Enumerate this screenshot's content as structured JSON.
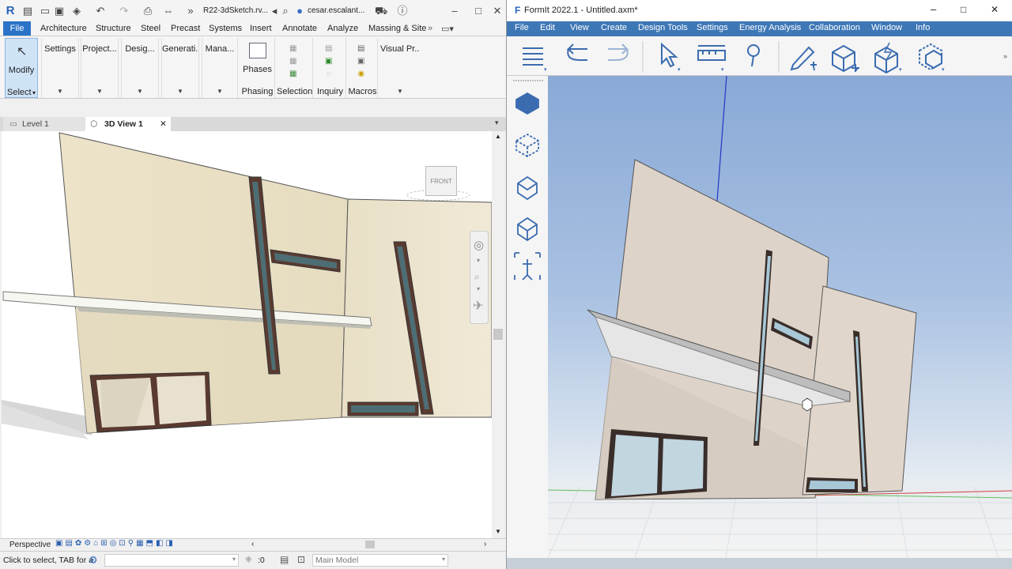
{
  "revit": {
    "qat_title": "R22-3dSketch.rv...",
    "user": "cesar.escalant...",
    "menu": {
      "file": "File",
      "items": [
        "Architecture",
        "Structure",
        "Steel",
        "Precast",
        "Systems",
        "Insert",
        "Annotate",
        "Analyze",
        "Massing & Site"
      ]
    },
    "ribbon": {
      "modify": "Modify",
      "select": "Select",
      "panels": [
        "Settings",
        "Project...",
        "Desig...",
        "Generati...",
        "Mana..."
      ],
      "phases": "Phases",
      "phasing": "Phasing",
      "selection": "Selection",
      "inquiry": "Inquiry",
      "macros": "Macros",
      "visual": "Visual Pr..."
    },
    "view_tabs": [
      "Level 1",
      "3D View 1"
    ],
    "viewcube_face": "FRONT",
    "view_control_label": "Perspective",
    "status": {
      "hint": "Click to select, TAB for a",
      "zero": ":0",
      "model": "Main Model"
    }
  },
  "formit": {
    "title": "FormIt 2022.1 - Untitled.axm*",
    "menu": [
      "File",
      "Edit",
      "View",
      "Create",
      "Design Tools",
      "Settings",
      "Energy Analysis",
      "Collaboration",
      "Window",
      "Info"
    ]
  }
}
